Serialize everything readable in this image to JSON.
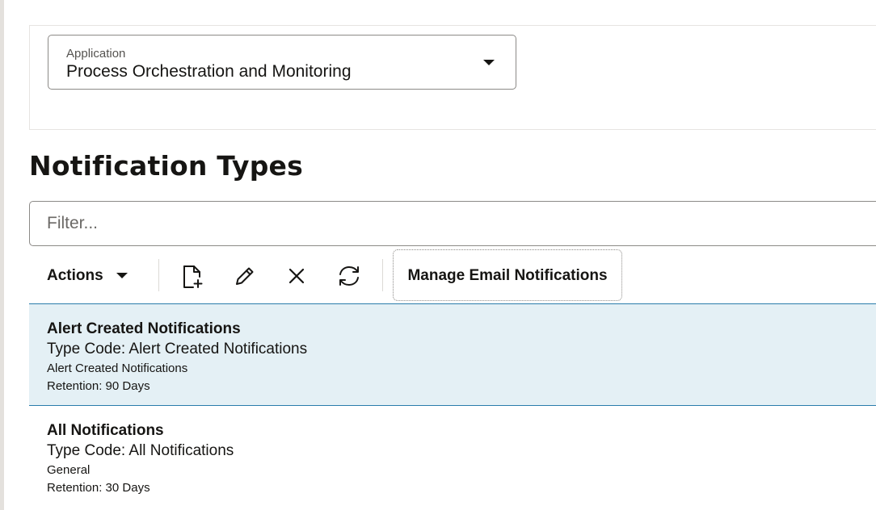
{
  "application": {
    "label": "Application",
    "value": "Process Orchestration and Monitoring"
  },
  "section": {
    "title": "Notification Types"
  },
  "filter": {
    "placeholder": "Filter...",
    "value": ""
  },
  "toolbar": {
    "actions_label": "Actions",
    "icons": [
      "create-icon",
      "edit-icon",
      "delete-icon",
      "refresh-icon"
    ],
    "manage_label": "Manage Email Notifications"
  },
  "notifications": [
    {
      "title": "Alert Created Notifications",
      "type_code": "Type Code: Alert Created Notifications",
      "description": "Alert Created Notifications",
      "retention": "Retention: 90 Days",
      "selected": true
    },
    {
      "title": "All Notifications",
      "type_code": "Type Code: All Notifications",
      "description": "General",
      "retention": "Retention: 30 Days",
      "selected": false
    }
  ],
  "colors": {
    "selected_row_bg": "#e4f0f5",
    "selected_row_border": "#2a7cab",
    "text": "#161513"
  }
}
